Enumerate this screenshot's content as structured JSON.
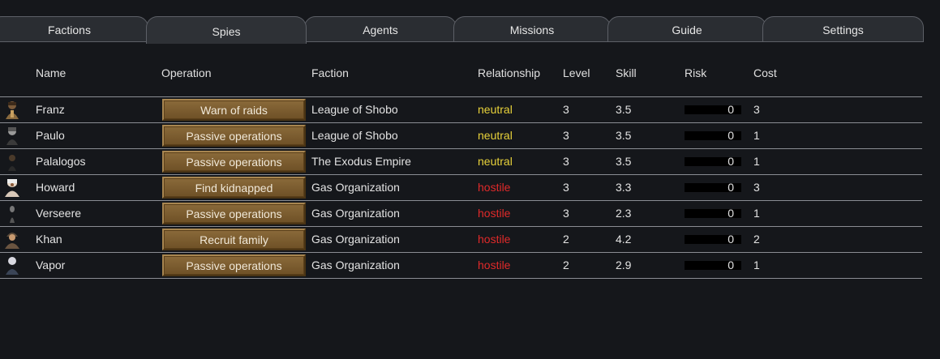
{
  "tabs": [
    {
      "label": "Factions",
      "active": false
    },
    {
      "label": "Spies",
      "active": true
    },
    {
      "label": "Agents",
      "active": false
    },
    {
      "label": "Missions",
      "active": false
    },
    {
      "label": "Guide",
      "active": false
    },
    {
      "label": "Settings",
      "active": false
    }
  ],
  "table": {
    "headers": {
      "name": "Name",
      "operation": "Operation",
      "faction": "Faction",
      "relationship": "Relationship",
      "level": "Level",
      "skill": "Skill",
      "risk": "Risk",
      "cost": "Cost"
    },
    "rows": [
      {
        "avatar": "pawn-portrait-icon",
        "name": "Franz",
        "operation": "Warn of raids",
        "faction": "League of Shobo",
        "relationship": "neutral",
        "level": "3",
        "skill": "3.5",
        "risk": "0",
        "cost": "3"
      },
      {
        "avatar": "pawn-portrait-icon",
        "name": "Paulo",
        "operation": "Passive operations",
        "faction": "League of Shobo",
        "relationship": "neutral",
        "level": "3",
        "skill": "3.5",
        "risk": "0",
        "cost": "1"
      },
      {
        "avatar": "pawn-portrait-icon",
        "name": "Palalogos",
        "operation": "Passive operations",
        "faction": "The Exodus Empire",
        "relationship": "neutral",
        "level": "3",
        "skill": "3.5",
        "risk": "0",
        "cost": "1"
      },
      {
        "avatar": "pawn-portrait-icon",
        "name": "Howard",
        "operation": "Find kidnapped",
        "faction": "Gas Organization",
        "relationship": "hostile",
        "level": "3",
        "skill": "3.3",
        "risk": "0",
        "cost": "3"
      },
      {
        "avatar": "pawn-portrait-icon",
        "name": "Verseere",
        "operation": "Passive operations",
        "faction": "Gas Organization",
        "relationship": "hostile",
        "level": "3",
        "skill": "2.3",
        "risk": "0",
        "cost": "1"
      },
      {
        "avatar": "pawn-portrait-icon",
        "name": "Khan",
        "operation": "Recruit family",
        "faction": "Gas Organization",
        "relationship": "hostile",
        "level": "2",
        "skill": "4.2",
        "risk": "0",
        "cost": "2"
      },
      {
        "avatar": "pawn-portrait-icon",
        "name": "Vapor",
        "operation": "Passive operations",
        "faction": "Gas Organization",
        "relationship": "hostile",
        "level": "2",
        "skill": "2.9",
        "risk": "0",
        "cost": "1"
      }
    ]
  },
  "colors": {
    "background": "#15171b",
    "neutral": "#e8d23a",
    "hostile": "#e02a2a",
    "button": "#7c5d30"
  }
}
